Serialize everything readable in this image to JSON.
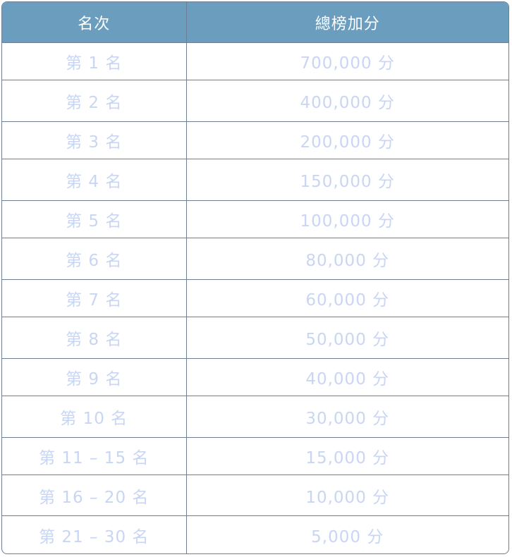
{
  "header": {
    "rank_label": "名次",
    "score_label": "總榜加分"
  },
  "rows": [
    {
      "rank": "第 1 名",
      "score": "700,000 分"
    },
    {
      "rank": "第 2 名",
      "score": "400,000 分"
    },
    {
      "rank": "第 3 名",
      "score": "200,000 分"
    },
    {
      "rank": "第 4 名",
      "score": "150,000 分"
    },
    {
      "rank": "第 5 名",
      "score": "100,000 分"
    },
    {
      "rank": "第 6 名",
      "score": "80,000 分"
    },
    {
      "rank": "第 7 名",
      "score": "60,000 分"
    },
    {
      "rank": "第 8 名",
      "score": "50,000 分"
    },
    {
      "rank": "第 9 名",
      "score": "40,000 分"
    },
    {
      "rank": "第 10 名",
      "score": "30,000 分"
    },
    {
      "rank": "第 11 – 15 名",
      "score": "15,000 分"
    },
    {
      "rank": "第 16 – 20 名",
      "score": "10,000 分"
    },
    {
      "rank": "第 21 – 30 名",
      "score": "5,000 分"
    }
  ],
  "colors": {
    "header_bg": "#6a9dbe",
    "header_text": "#ffffff",
    "cell_text": "#c9d6f3",
    "border": "#6e7f95"
  }
}
